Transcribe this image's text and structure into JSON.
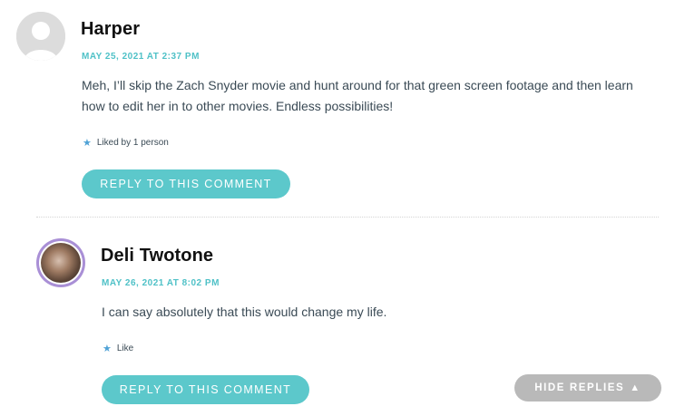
{
  "comments": [
    {
      "author": "Harper",
      "date": "MAY 25, 2021 AT 2:37 PM",
      "text_line1": "Meh, I’ll skip the Zach Snyder movie and hunt around for that green screen footage and then learn",
      "text_line2": "how to edit her in to other movies. Endless possibilities!",
      "like_label": "Liked by 1 person",
      "reply_label": "REPLY TO THIS COMMENT"
    },
    {
      "author": "Deli Twotone",
      "date": "MAY 26, 2021 AT 8:02 PM",
      "text_line1": "I can say absolutely that this would change my life.",
      "like_label": "Like",
      "reply_label": "REPLY TO THIS COMMENT"
    }
  ],
  "hide_replies": {
    "label": "HIDE REPLIES",
    "icon": "▲"
  },
  "colors": {
    "accent": "#5cc8cb",
    "date": "#4fc1c7",
    "star": "#4fa2d6",
    "hide_button": "#b9b9b9"
  }
}
